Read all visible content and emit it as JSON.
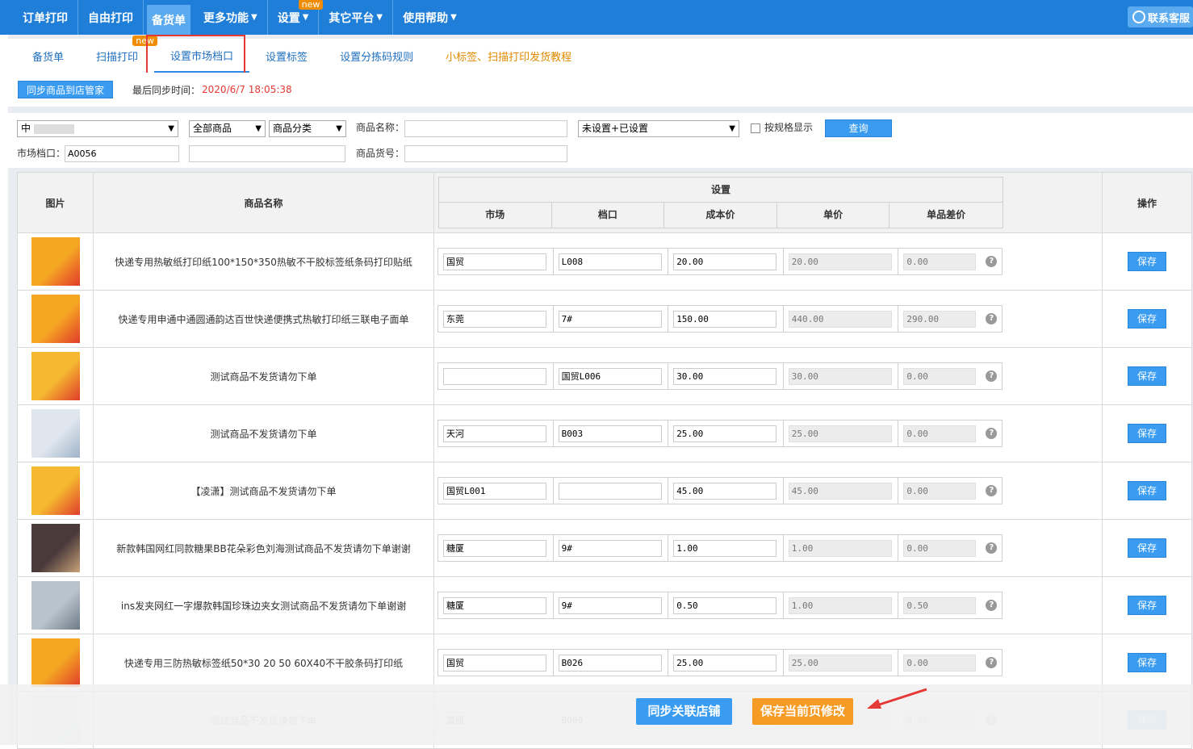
{
  "topnav": {
    "items": [
      {
        "label": "订单打印",
        "arrow": ""
      },
      {
        "label": "自由打印",
        "arrow": ""
      },
      {
        "label": "备货单",
        "arrow": "",
        "active": true
      },
      {
        "label": "更多功能",
        "arrow": "▼"
      },
      {
        "label": "设置",
        "arrow": "▼",
        "badge": "new"
      },
      {
        "label": "其它平台",
        "arrow": "▼"
      },
      {
        "label": "使用帮助",
        "arrow": "▼"
      }
    ],
    "service": "联系客服"
  },
  "subtabs": [
    {
      "label": "备货单"
    },
    {
      "label": "扫描打印",
      "badge": "new"
    },
    {
      "label": "设置市场档口"
    },
    {
      "label": "设置标签"
    },
    {
      "label": "设置分拣码规则"
    },
    {
      "label": "小标签、扫描打印发货教程"
    }
  ],
  "sync": {
    "button": "同步商品到店管家",
    "label": "最后同步时间：",
    "time": "2020/6/7 18:05:38"
  },
  "filter": {
    "shop": "中",
    "goods_scope": "全部商品",
    "category": "商品分类",
    "name_label": "商品名称：",
    "name_value": "",
    "setting_status": "未设置+已设置",
    "by_spec": "按规格显示",
    "query": "查询",
    "market_label": "市场档口：",
    "market_value": "A0056",
    "extra_value": "",
    "sku_label": "商品货号：",
    "sku_value": ""
  },
  "table": {
    "headers": {
      "image": "图片",
      "name": "商品名称",
      "settings": "设置",
      "market": "市场",
      "stall": "档口",
      "cost": "成本价",
      "price": "单价",
      "diff": "单品差价",
      "op": "操作"
    },
    "save_label": "保存",
    "help": "?",
    "rows": [
      {
        "name": "快递专用热敏纸打印纸100*150*350热敏不干胶标签纸条码打印贴纸",
        "market": "国贸",
        "stall": "L008",
        "cost": "20.00",
        "price": "20.00",
        "diff": "0.00"
      },
      {
        "name": "快递专用申通中通圆通韵达百世快递便携式热敏打印纸三联电子面单",
        "market": "东莞",
        "stall": "7#",
        "cost": "150.00",
        "price": "440.00",
        "diff": "290.00"
      },
      {
        "name": "测试商品不发货请勿下单",
        "market": "",
        "stall": "国贸L006",
        "cost": "30.00",
        "price": "30.00",
        "diff": "0.00"
      },
      {
        "name": "测试商品不发货请勿下单",
        "market": "天河",
        "stall": "B003",
        "cost": "25.00",
        "price": "25.00",
        "diff": "0.00"
      },
      {
        "name": "【凌潇】测试商品不发货请勿下单",
        "market": "国贸L001",
        "stall": "",
        "cost": "45.00",
        "price": "45.00",
        "diff": "0.00"
      },
      {
        "name": "新款韩国网红同款糖果BB花朵彩色刘海测试商品不发货请勿下单谢谢",
        "market": "糖厦",
        "stall": "9#",
        "cost": "1.00",
        "price": "1.00",
        "diff": "0.00"
      },
      {
        "name": "ins发夹网红一字爆款韩国珍珠边夹女测试商品不发货请勿下单谢谢",
        "market": "糖厦",
        "stall": "9#",
        "cost": "0.50",
        "price": "1.00",
        "diff": "0.50"
      },
      {
        "name": "快递专用三防热敏标签纸50*30 20 50 60X40不干胶条码打印纸",
        "market": "国贸",
        "stall": "B026",
        "cost": "25.00",
        "price": "25.00",
        "diff": "0.00"
      },
      {
        "name": "测试商品不发货请勿下单",
        "market": "富丽",
        "stall": "B009",
        "cost": "",
        "price": "",
        "diff": "0.00"
      }
    ]
  },
  "bottom": {
    "sync_shops": "同步关联店铺",
    "save_page": "保存当前页修改"
  },
  "colors": {
    "nav": "#1f7fd8",
    "primary": "#3a9cf0",
    "orange": "#f59a23",
    "red": "#e53935"
  }
}
